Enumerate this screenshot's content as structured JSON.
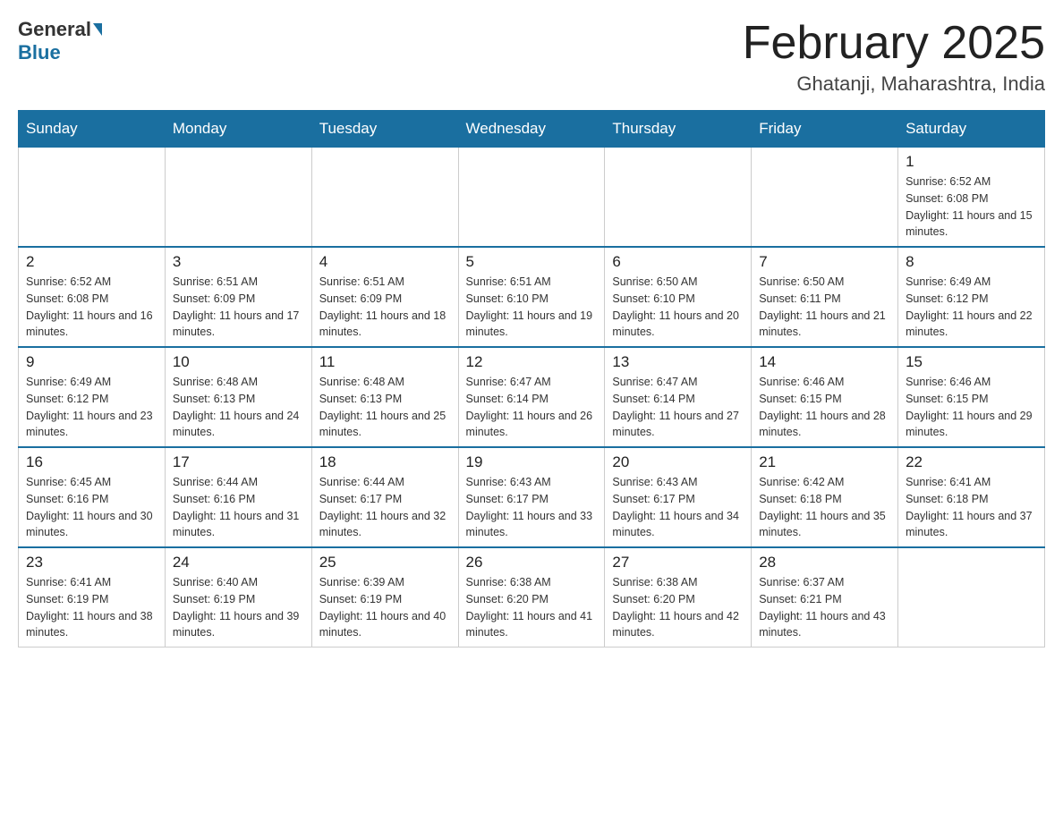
{
  "header": {
    "logo_general": "General",
    "logo_blue": "Blue",
    "month_title": "February 2025",
    "location": "Ghatanji, Maharashtra, India"
  },
  "days_of_week": [
    "Sunday",
    "Monday",
    "Tuesday",
    "Wednesday",
    "Thursday",
    "Friday",
    "Saturday"
  ],
  "weeks": [
    [
      {
        "day": "",
        "info": ""
      },
      {
        "day": "",
        "info": ""
      },
      {
        "day": "",
        "info": ""
      },
      {
        "day": "",
        "info": ""
      },
      {
        "day": "",
        "info": ""
      },
      {
        "day": "",
        "info": ""
      },
      {
        "day": "1",
        "info": "Sunrise: 6:52 AM\nSunset: 6:08 PM\nDaylight: 11 hours and 15 minutes."
      }
    ],
    [
      {
        "day": "2",
        "info": "Sunrise: 6:52 AM\nSunset: 6:08 PM\nDaylight: 11 hours and 16 minutes."
      },
      {
        "day": "3",
        "info": "Sunrise: 6:51 AM\nSunset: 6:09 PM\nDaylight: 11 hours and 17 minutes."
      },
      {
        "day": "4",
        "info": "Sunrise: 6:51 AM\nSunset: 6:09 PM\nDaylight: 11 hours and 18 minutes."
      },
      {
        "day": "5",
        "info": "Sunrise: 6:51 AM\nSunset: 6:10 PM\nDaylight: 11 hours and 19 minutes."
      },
      {
        "day": "6",
        "info": "Sunrise: 6:50 AM\nSunset: 6:10 PM\nDaylight: 11 hours and 20 minutes."
      },
      {
        "day": "7",
        "info": "Sunrise: 6:50 AM\nSunset: 6:11 PM\nDaylight: 11 hours and 21 minutes."
      },
      {
        "day": "8",
        "info": "Sunrise: 6:49 AM\nSunset: 6:12 PM\nDaylight: 11 hours and 22 minutes."
      }
    ],
    [
      {
        "day": "9",
        "info": "Sunrise: 6:49 AM\nSunset: 6:12 PM\nDaylight: 11 hours and 23 minutes."
      },
      {
        "day": "10",
        "info": "Sunrise: 6:48 AM\nSunset: 6:13 PM\nDaylight: 11 hours and 24 minutes."
      },
      {
        "day": "11",
        "info": "Sunrise: 6:48 AM\nSunset: 6:13 PM\nDaylight: 11 hours and 25 minutes."
      },
      {
        "day": "12",
        "info": "Sunrise: 6:47 AM\nSunset: 6:14 PM\nDaylight: 11 hours and 26 minutes."
      },
      {
        "day": "13",
        "info": "Sunrise: 6:47 AM\nSunset: 6:14 PM\nDaylight: 11 hours and 27 minutes."
      },
      {
        "day": "14",
        "info": "Sunrise: 6:46 AM\nSunset: 6:15 PM\nDaylight: 11 hours and 28 minutes."
      },
      {
        "day": "15",
        "info": "Sunrise: 6:46 AM\nSunset: 6:15 PM\nDaylight: 11 hours and 29 minutes."
      }
    ],
    [
      {
        "day": "16",
        "info": "Sunrise: 6:45 AM\nSunset: 6:16 PM\nDaylight: 11 hours and 30 minutes."
      },
      {
        "day": "17",
        "info": "Sunrise: 6:44 AM\nSunset: 6:16 PM\nDaylight: 11 hours and 31 minutes."
      },
      {
        "day": "18",
        "info": "Sunrise: 6:44 AM\nSunset: 6:17 PM\nDaylight: 11 hours and 32 minutes."
      },
      {
        "day": "19",
        "info": "Sunrise: 6:43 AM\nSunset: 6:17 PM\nDaylight: 11 hours and 33 minutes."
      },
      {
        "day": "20",
        "info": "Sunrise: 6:43 AM\nSunset: 6:17 PM\nDaylight: 11 hours and 34 minutes."
      },
      {
        "day": "21",
        "info": "Sunrise: 6:42 AM\nSunset: 6:18 PM\nDaylight: 11 hours and 35 minutes."
      },
      {
        "day": "22",
        "info": "Sunrise: 6:41 AM\nSunset: 6:18 PM\nDaylight: 11 hours and 37 minutes."
      }
    ],
    [
      {
        "day": "23",
        "info": "Sunrise: 6:41 AM\nSunset: 6:19 PM\nDaylight: 11 hours and 38 minutes."
      },
      {
        "day": "24",
        "info": "Sunrise: 6:40 AM\nSunset: 6:19 PM\nDaylight: 11 hours and 39 minutes."
      },
      {
        "day": "25",
        "info": "Sunrise: 6:39 AM\nSunset: 6:19 PM\nDaylight: 11 hours and 40 minutes."
      },
      {
        "day": "26",
        "info": "Sunrise: 6:38 AM\nSunset: 6:20 PM\nDaylight: 11 hours and 41 minutes."
      },
      {
        "day": "27",
        "info": "Sunrise: 6:38 AM\nSunset: 6:20 PM\nDaylight: 11 hours and 42 minutes."
      },
      {
        "day": "28",
        "info": "Sunrise: 6:37 AM\nSunset: 6:21 PM\nDaylight: 11 hours and 43 minutes."
      },
      {
        "day": "",
        "info": ""
      }
    ]
  ]
}
